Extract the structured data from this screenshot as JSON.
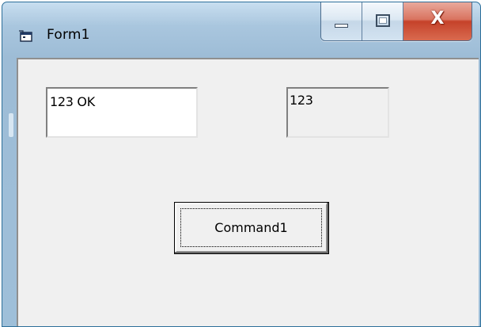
{
  "window": {
    "title": "Form1",
    "icon": "form-icon"
  },
  "caption_buttons": {
    "minimize_icon": "minimize-icon",
    "maximize_icon": "maximize-icon",
    "close_icon": "close-icon",
    "close_glyph": "X"
  },
  "form": {
    "textbox1_value": "123 OK",
    "textbox2_value": "123",
    "command_button_label": "Command1"
  },
  "colors": {
    "frame": "#a9c6de",
    "client": "#f0f0f0",
    "close_button": "#c5422a"
  }
}
